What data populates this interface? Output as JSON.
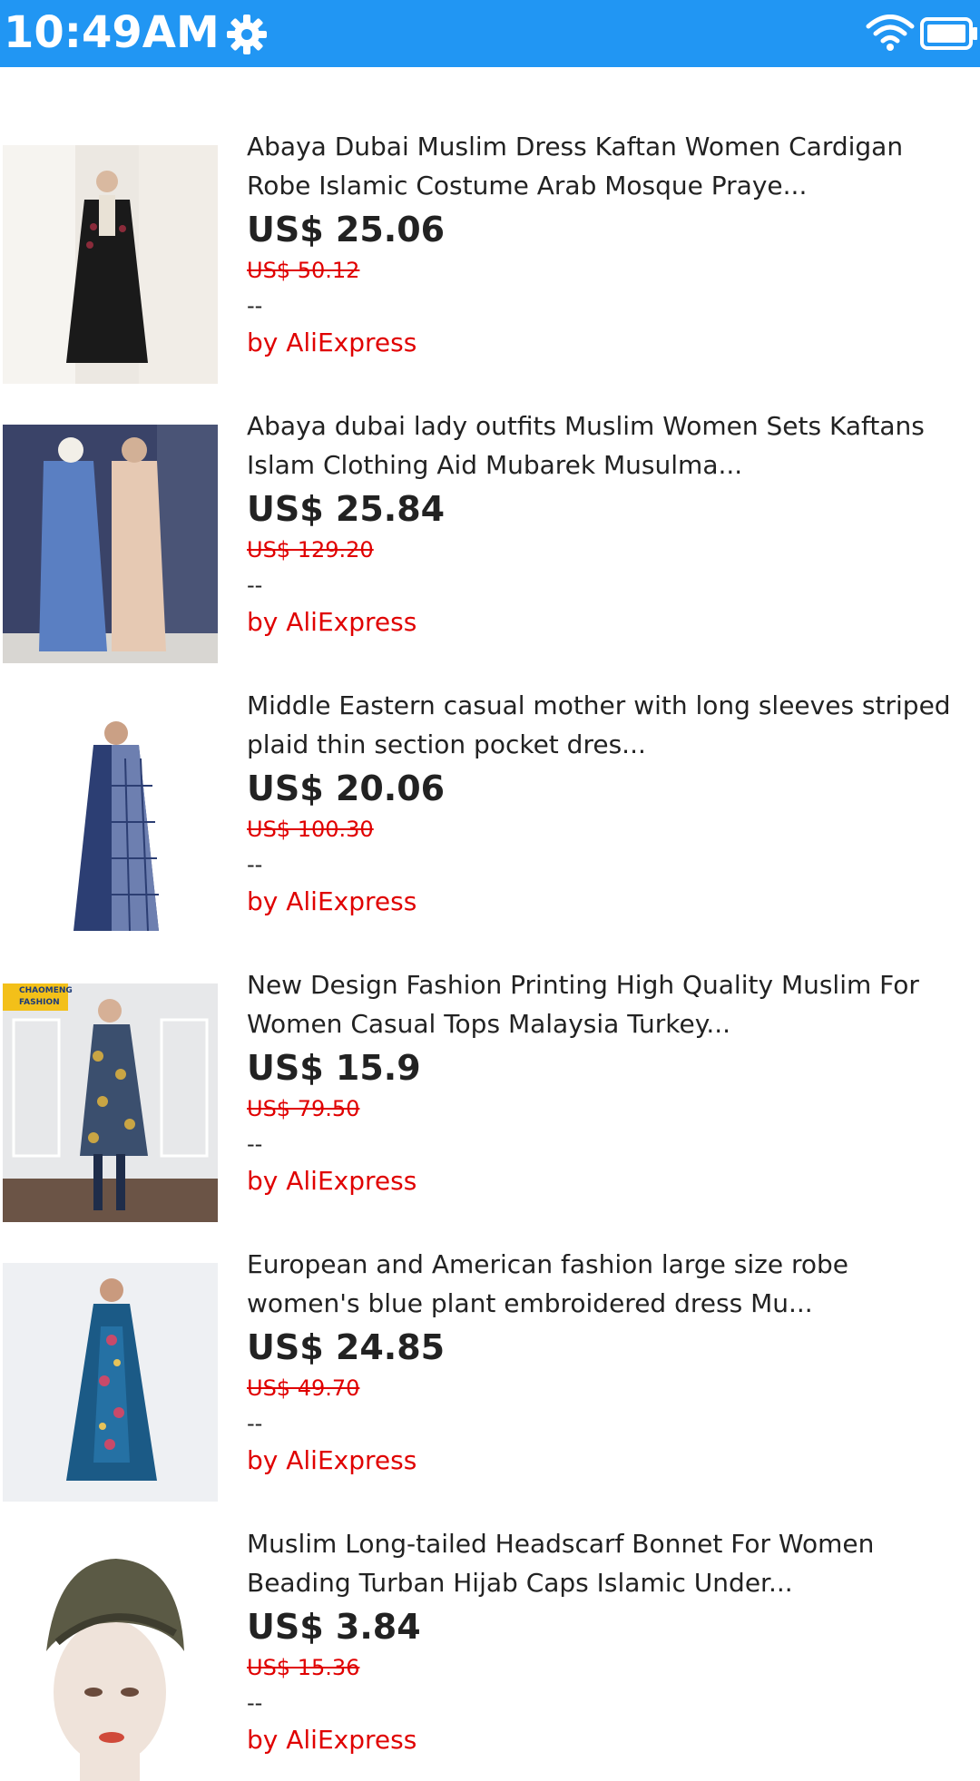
{
  "status_bar": {
    "time": "10:49AM",
    "background": "#2196F3",
    "icons": [
      "gear-icon",
      "wifi-icon",
      "battery-icon"
    ]
  },
  "products": [
    {
      "title_line1": "Abaya Dubai Muslim Dress Kaftan Women Cardigan",
      "title_line2": "Robe Islamic Costume Arab Mosque Praye...",
      "price": "US$ 25.06",
      "old_price": "US$ 50.12",
      "rating": "--",
      "seller": "by AliExpress",
      "image": "black-abaya-photo"
    },
    {
      "title_line1": "Abaya dubai lady outfits Muslim Women Sets Kaftans",
      "title_line2": "Islam Clothing Aid Mubarek Musulma...",
      "price": "US$ 25.84",
      "old_price": "US$ 129.20",
      "rating": "--",
      "seller": "by AliExpress",
      "image": "two-piece-outfits-photo"
    },
    {
      "title_line1": "Middle Eastern casual mother with long sleeves striped",
      "title_line2": "plaid thin section pocket dres...",
      "price": "US$ 20.06",
      "old_price": "US$ 100.30",
      "rating": "--",
      "seller": "by AliExpress",
      "image": "plaid-dress-photo"
    },
    {
      "title_line1": "New Design Fashion Printing High Quality Muslim For",
      "title_line2": "Women Casual Tops Malaysia Turkey...",
      "price": "US$ 15.9",
      "old_price": "US$ 79.50",
      "rating": "--",
      "seller": "by AliExpress",
      "image": "printed-tunic-photo",
      "brand_badge": "CHAOMENG FASHION"
    },
    {
      "title_line1": "European and American fashion large size robe",
      "title_line2": "women's blue plant embroidered dress Mu...",
      "price": "US$ 24.85",
      "old_price": "US$ 49.70",
      "rating": "--",
      "seller": "by AliExpress",
      "image": "blue-velvet-dress-photo"
    },
    {
      "title_line1": "Muslim Long-tailed Headscarf Bonnet For Women",
      "title_line2": "Beading Turban Hijab Caps Islamic Under...",
      "price": "US$ 3.84",
      "old_price": "US$ 15.36",
      "rating": "--",
      "seller": "by AliExpress",
      "image": "turban-mannequin-photo"
    }
  ]
}
